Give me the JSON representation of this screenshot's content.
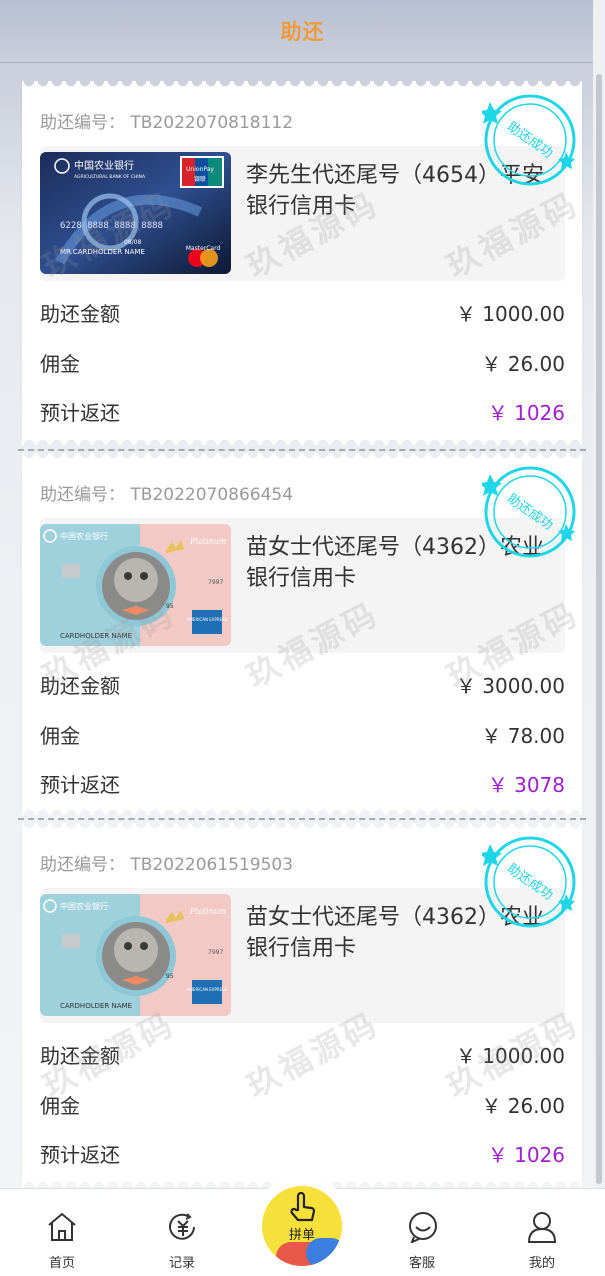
{
  "header": {
    "title": "助还"
  },
  "labels": {
    "order_prefix": "助还编号：",
    "amount": "助还金额",
    "commission": "佣金",
    "expected_return": "预计返还",
    "stamp_text": "助还成功"
  },
  "records": [
    {
      "order_no": "TB2022070818112",
      "card_name": "李先生代还尾号（4654）平安银行信用卡",
      "amount": "￥ 1000.00",
      "commission": "￥ 26.00",
      "expected_return": "￥ 1026",
      "card_style": "abc-blue"
    },
    {
      "order_no": "TB2022070866454",
      "card_name": "苗女士代还尾号（4362）农业银行信用卡",
      "amount": "￥ 3000.00",
      "commission": "￥ 78.00",
      "expected_return": "￥ 3078",
      "card_style": "abc-cat"
    },
    {
      "order_no": "TB2022061519503",
      "card_name": "苗女士代还尾号（4362）农业银行信用卡",
      "amount": "￥ 1000.00",
      "commission": "￥ 26.00",
      "expected_return": "￥ 1026",
      "card_style": "abc-cat"
    }
  ],
  "card_art": {
    "bank_name_cn": "中国农业银行",
    "bank_name_en": "AGRICULTURAL BANK OF CHINA",
    "unionpay": "UnionPay",
    "unionpay_cn": "银联",
    "mastercard": "MasterCard",
    "holder": "CARDHOLDER NAME",
    "holder_mr": "MR.CARDHOLDER NAME",
    "card_no": "6228 8888 8888 8888",
    "expiry": "08/08",
    "platinum": "Platinum",
    "amex": "AMERICAN EXPRESS",
    "num_7997": "7997",
    "num_95": "95"
  },
  "watermark": "玖福源码",
  "tabbar": {
    "home": "首页",
    "records": "记录",
    "center": "拼单",
    "service": "客服",
    "mine": "我的"
  },
  "colors": {
    "title": "#f29a3a",
    "accent_purple": "#a21fd0",
    "stamp": "#1fd6e8"
  }
}
